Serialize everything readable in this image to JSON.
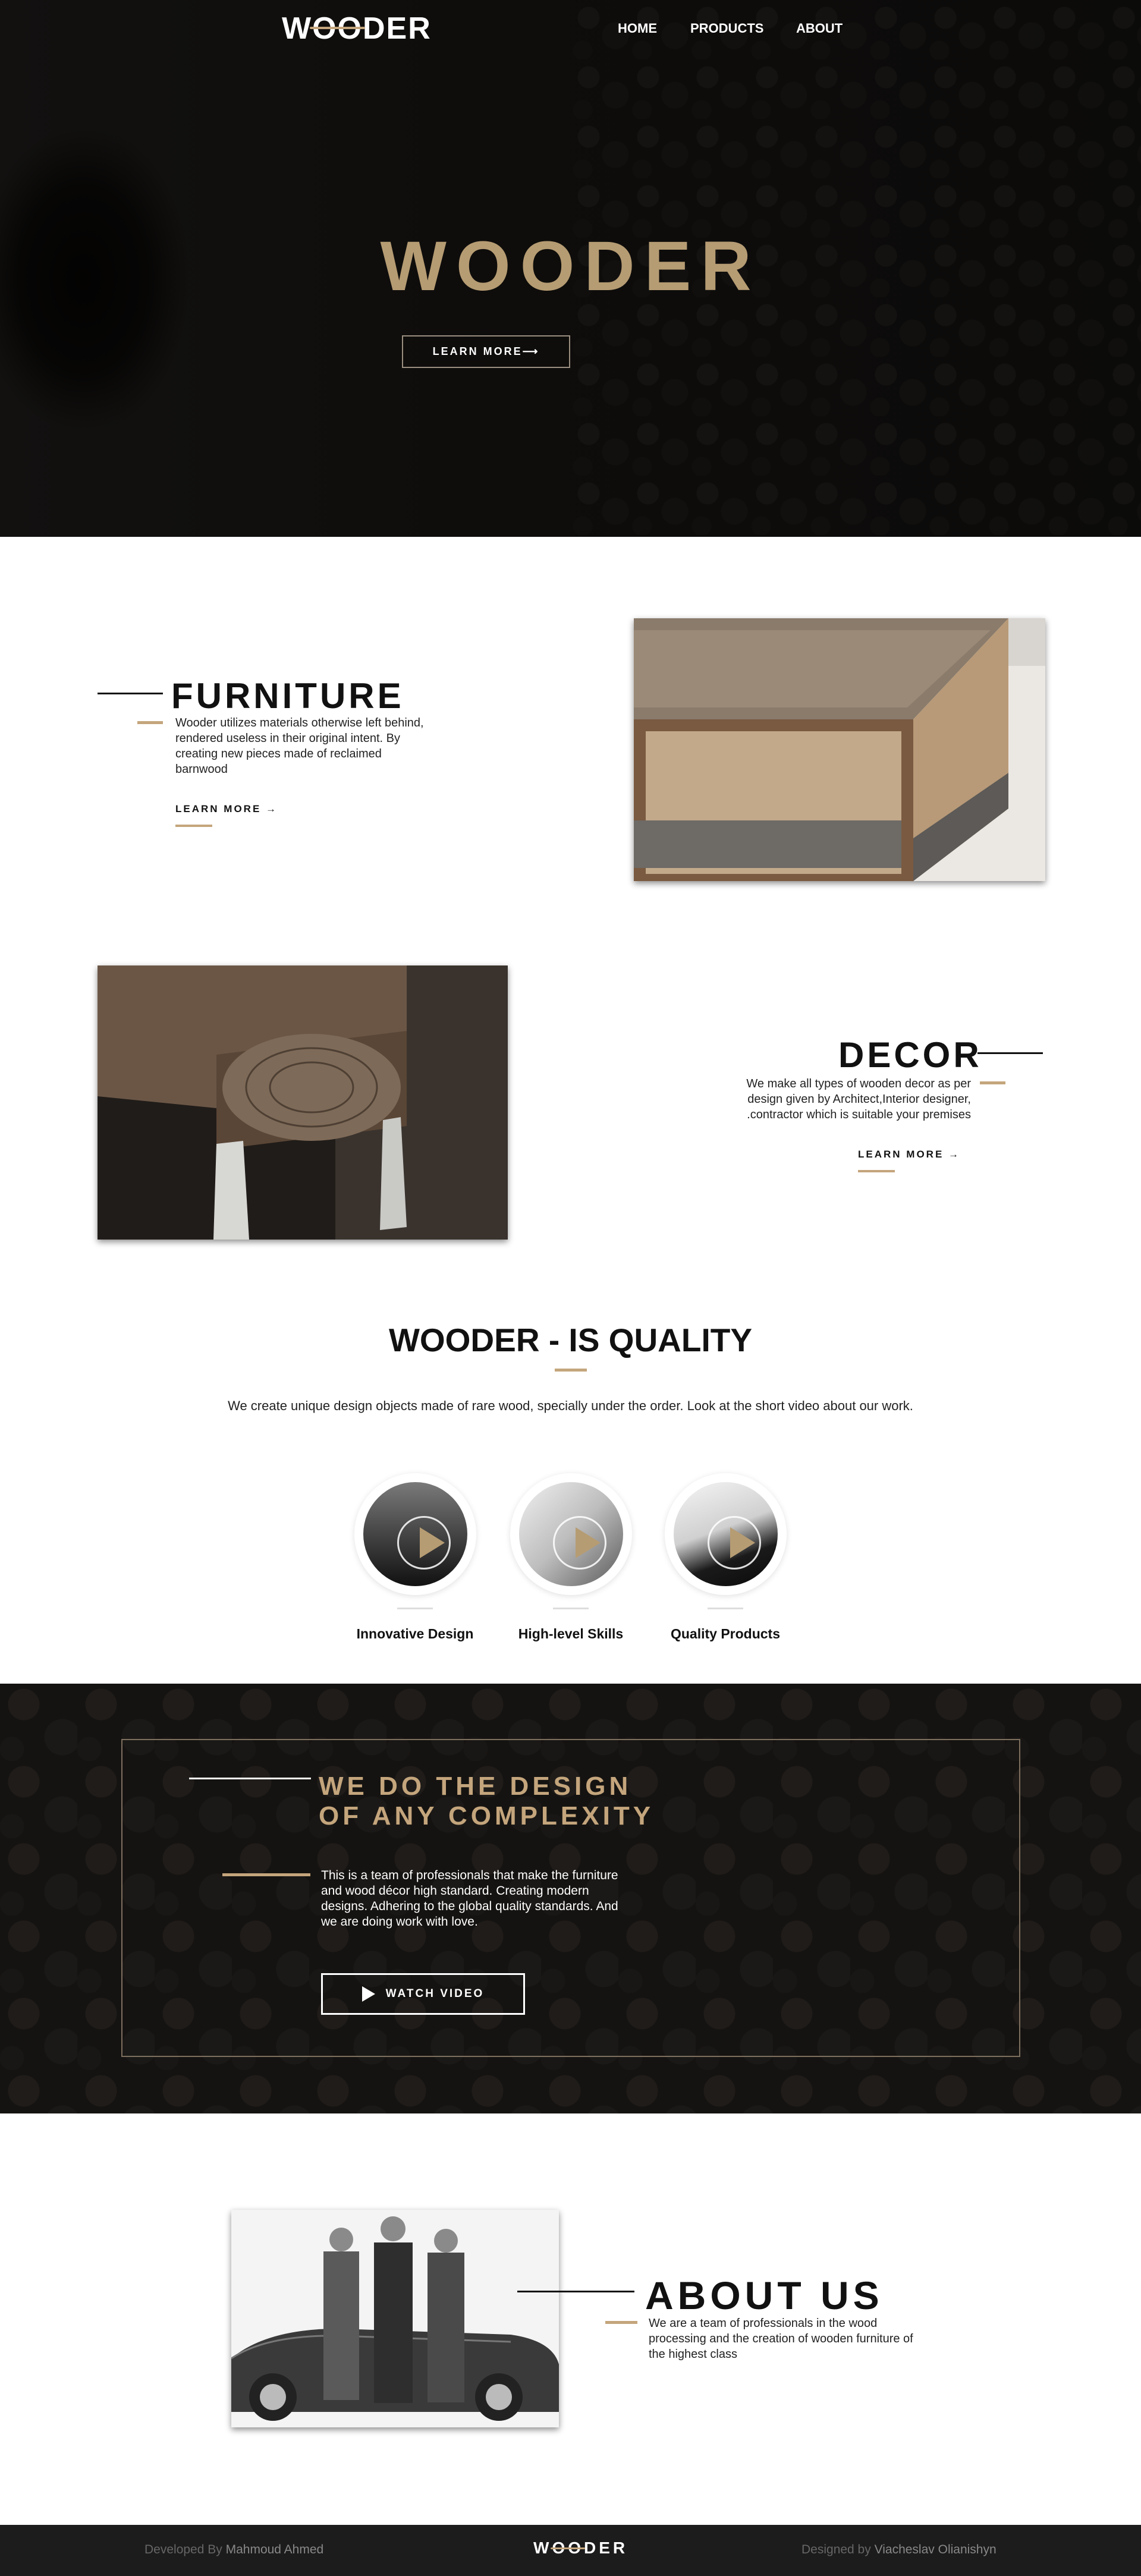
{
  "nav": {
    "logo": {
      "prefix": "W",
      "o1": "O",
      "o2": "O",
      "suffix": "DER"
    },
    "links": [
      "HOME",
      "PRODUCTS",
      "ABOUT"
    ]
  },
  "hero": {
    "title": "WOODER",
    "button": "LEARN MORE⟶"
  },
  "furniture": {
    "title": "FURNITURE",
    "text": "Wooder utilizes materials otherwise left behind, rendered useless in their original intent. By creating new pieces made of reclaimed barnwood",
    "learn_more": "LEARN MORE →"
  },
  "decor": {
    "title": "DECOR",
    "text": "We make all types of wooden decor as per design given by Architect,Interior designer, .contractor which is suitable your premises",
    "learn_more": "LEARN MORE →"
  },
  "quality": {
    "title": "WOODER - IS QUALITY",
    "subtitle": "We create unique design objects made of rare wood, specially under the order. Look at the short video about our work.",
    "videos": [
      {
        "caption": "Innovative Design"
      },
      {
        "caption": "High-level Skills"
      },
      {
        "caption": "Quality Products"
      }
    ]
  },
  "design": {
    "title_line1": "WE DO THE DESIGN",
    "title_line2": "OF ANY COMPLEXITY",
    "text": "This is a team of professionals that make the furniture and wood décor high standard. Creating modern designs. Adhering to the global quality standards. And we are doing work with love.",
    "button": "WATCH VIDEO"
  },
  "about": {
    "title": "ABOUT US",
    "text": "We are a team of professionals in the wood processing and the creation of wooden furniture of the highest class"
  },
  "footer": {
    "developed_by_label": "Developed By",
    "developer": "Mahmoud Ahmed",
    "logo": {
      "prefix": "W",
      "o1": "O",
      "o2": "O",
      "suffix": "DER"
    },
    "designed_by_label": "Designed by",
    "designer": "Viacheslav Olianishyn"
  },
  "colors": {
    "accent_gold": "#c4a57c",
    "hero_title": "#b69c73",
    "dark_bg": "#151311",
    "footer_bg": "#1c1c1c"
  },
  "icons": [
    "play-icon",
    "arrow-right-icon"
  ]
}
